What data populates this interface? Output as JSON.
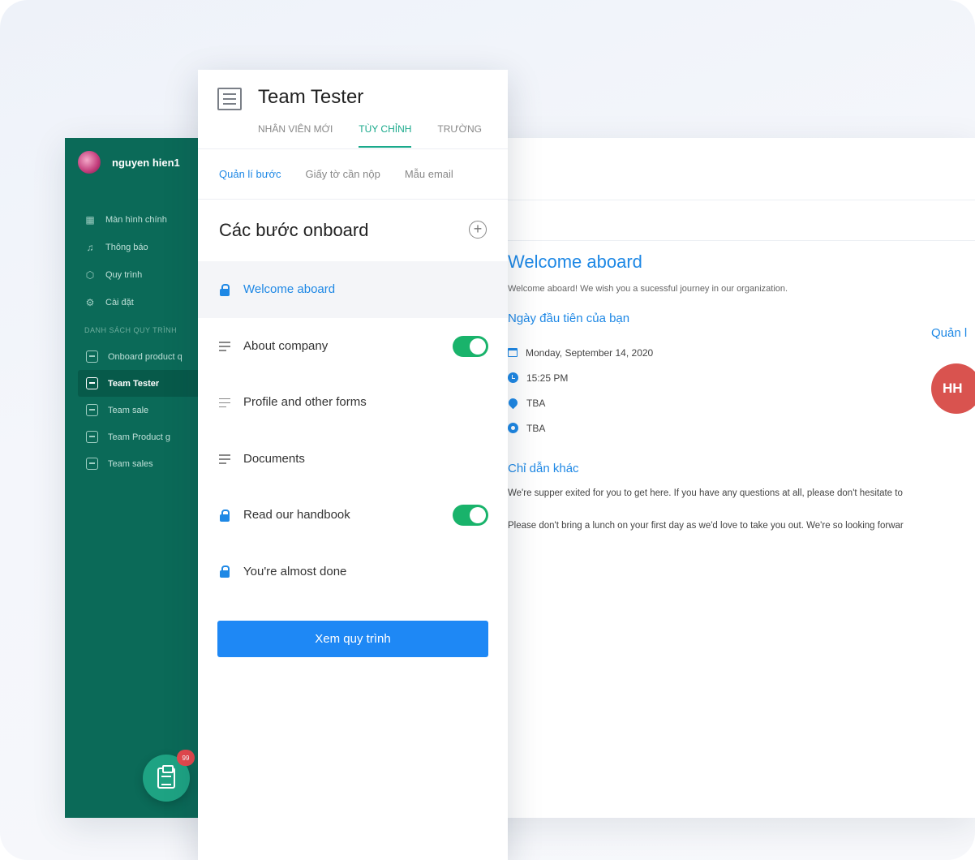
{
  "sidebar": {
    "user_name": "nguyen hien1",
    "menu": [
      {
        "label": "Màn hình chính",
        "icon": "grid-icon"
      },
      {
        "label": "Thông báo",
        "icon": "bell-icon"
      },
      {
        "label": "Quy trình",
        "icon": "cube-icon"
      },
      {
        "label": "Cài đặt",
        "icon": "gear-icon"
      }
    ],
    "section_title": "DANH SÁCH QUY TRÌNH",
    "process_list": [
      {
        "label": "Onboard product q",
        "active": false
      },
      {
        "label": "Team Tester",
        "active": true
      },
      {
        "label": "Team sale",
        "active": false
      },
      {
        "label": "Team Product g",
        "active": false
      },
      {
        "label": "Team sales",
        "active": false
      }
    ],
    "fab_badge": "99"
  },
  "card": {
    "title": "Team Tester",
    "tabs": [
      {
        "label": "NHÂN VIÊN MỚI",
        "active": false
      },
      {
        "label": "TÙY CHỈNH",
        "active": true
      },
      {
        "label": "TRƯỜNG",
        "active": false
      }
    ],
    "subtabs": [
      {
        "label": "Quản lí bước",
        "active": true
      },
      {
        "label": "Giấy tờ cần nộp",
        "active": false
      },
      {
        "label": "Mẫu email",
        "active": false
      }
    ],
    "steps_title": "Các bước onboard",
    "steps": [
      {
        "label": "Welcome aboard",
        "icon": "lock-icon",
        "toggle": false,
        "active": true
      },
      {
        "label": "About company",
        "icon": "drag-lines-icon",
        "toggle": true,
        "active": false
      },
      {
        "label": "Profile and other forms",
        "icon": "drag-lines-icon",
        "toggle": false,
        "active": false
      },
      {
        "label": "Documents",
        "icon": "drag-lines-icon",
        "toggle": false,
        "active": false
      },
      {
        "label": "Read our handbook",
        "icon": "lock-icon",
        "toggle": true,
        "active": false
      },
      {
        "label": "You're almost done",
        "icon": "lock-icon",
        "toggle": false,
        "active": false
      }
    ],
    "view_button": "Xem quy trình"
  },
  "preview": {
    "title": "Welcome aboard",
    "description": "Welcome aboard! We wish you a sucessful journey in our organization.",
    "first_day_title": "Ngày đầu tiên của bạn",
    "manager_title": "Quản l",
    "info": [
      {
        "icon": "calendar-icon",
        "text": "Monday, September 14, 2020"
      },
      {
        "icon": "clock-icon",
        "text": "15:25 PM"
      },
      {
        "icon": "location-pin-icon",
        "text": "TBA"
      },
      {
        "icon": "target-icon",
        "text": "TBA"
      }
    ],
    "manager_avatar": "HH",
    "other_title": "Chỉ dẫn khác",
    "paragraphs": [
      "We're supper exited for you to get here. If you have any questions at all, please don't hesitate to",
      "Please don't bring a lunch on your first day as we'd love to take you out. We're so looking forwar"
    ]
  },
  "colors": {
    "sidebar_bg": "#0b6a58",
    "accent_blue": "#1e88e5",
    "accent_green": "#19a98b",
    "toggle_on": "#19b36b",
    "avatar_red": "#d9534f"
  }
}
